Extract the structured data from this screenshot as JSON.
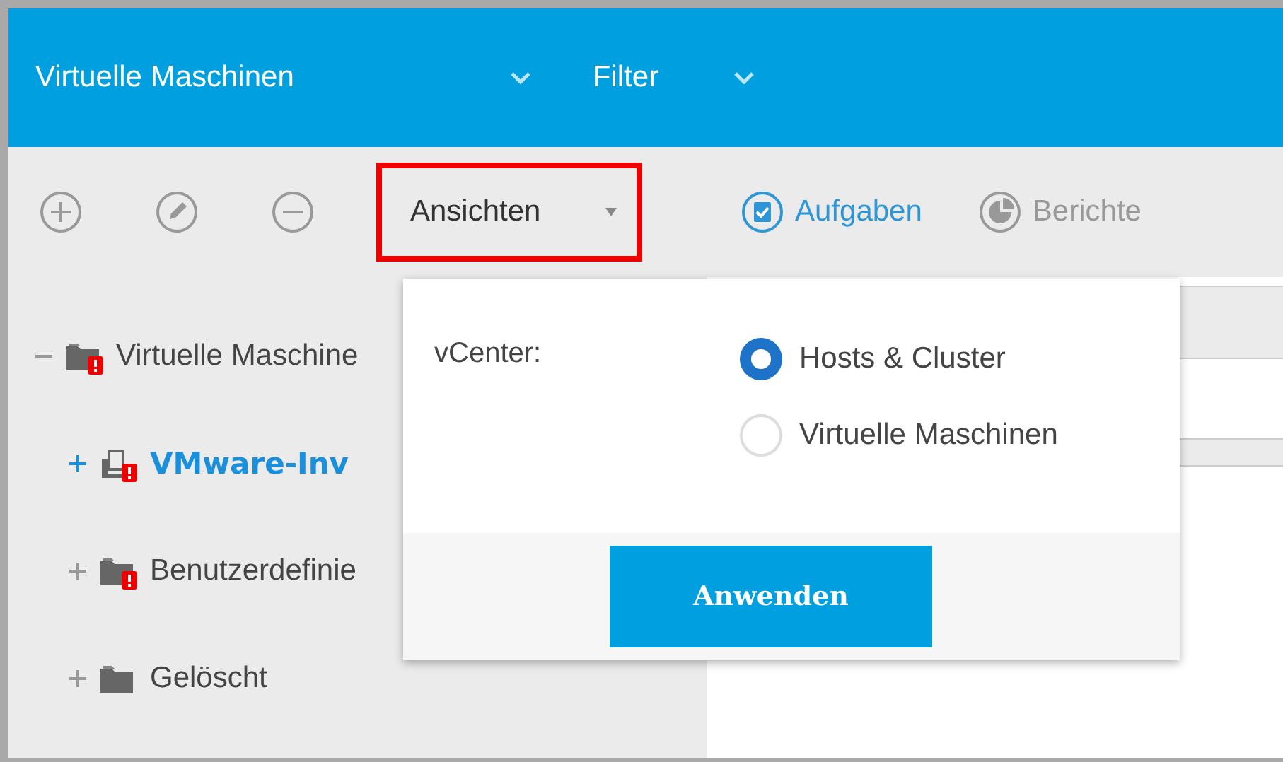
{
  "header": {
    "title": "Virtuelle Maschinen",
    "filter": "Filter"
  },
  "toolbar": {
    "views_button": {
      "label": "Ansichten",
      "highlighted": true
    }
  },
  "tabs": [
    {
      "label": "Aufgaben",
      "selected": true,
      "kind": "tasks"
    },
    {
      "label": "Berichte",
      "selected": false,
      "kind": "reports"
    }
  ],
  "tree": [
    {
      "label": "Virtuelle Maschine",
      "kind": "folder",
      "warning": true,
      "expanded": true,
      "selected": false,
      "children": [
        {
          "label": "VMware-Inv",
          "kind": "hosts",
          "warning": true,
          "expanded": false,
          "selected": true
        },
        {
          "label": "Benutzerdefinie",
          "kind": "folder",
          "warning": true,
          "expanded": false,
          "selected": false
        },
        {
          "label": "Gelöscht",
          "kind": "folder",
          "warning": false,
          "expanded": false,
          "selected": false
        }
      ]
    }
  ],
  "popup": {
    "label": "vCenter:",
    "options": [
      {
        "label": "Hosts & Cluster",
        "selected": true
      },
      {
        "label": "Virtuelle Maschinen",
        "selected": false
      }
    ],
    "apply_button": "Anwenden"
  }
}
